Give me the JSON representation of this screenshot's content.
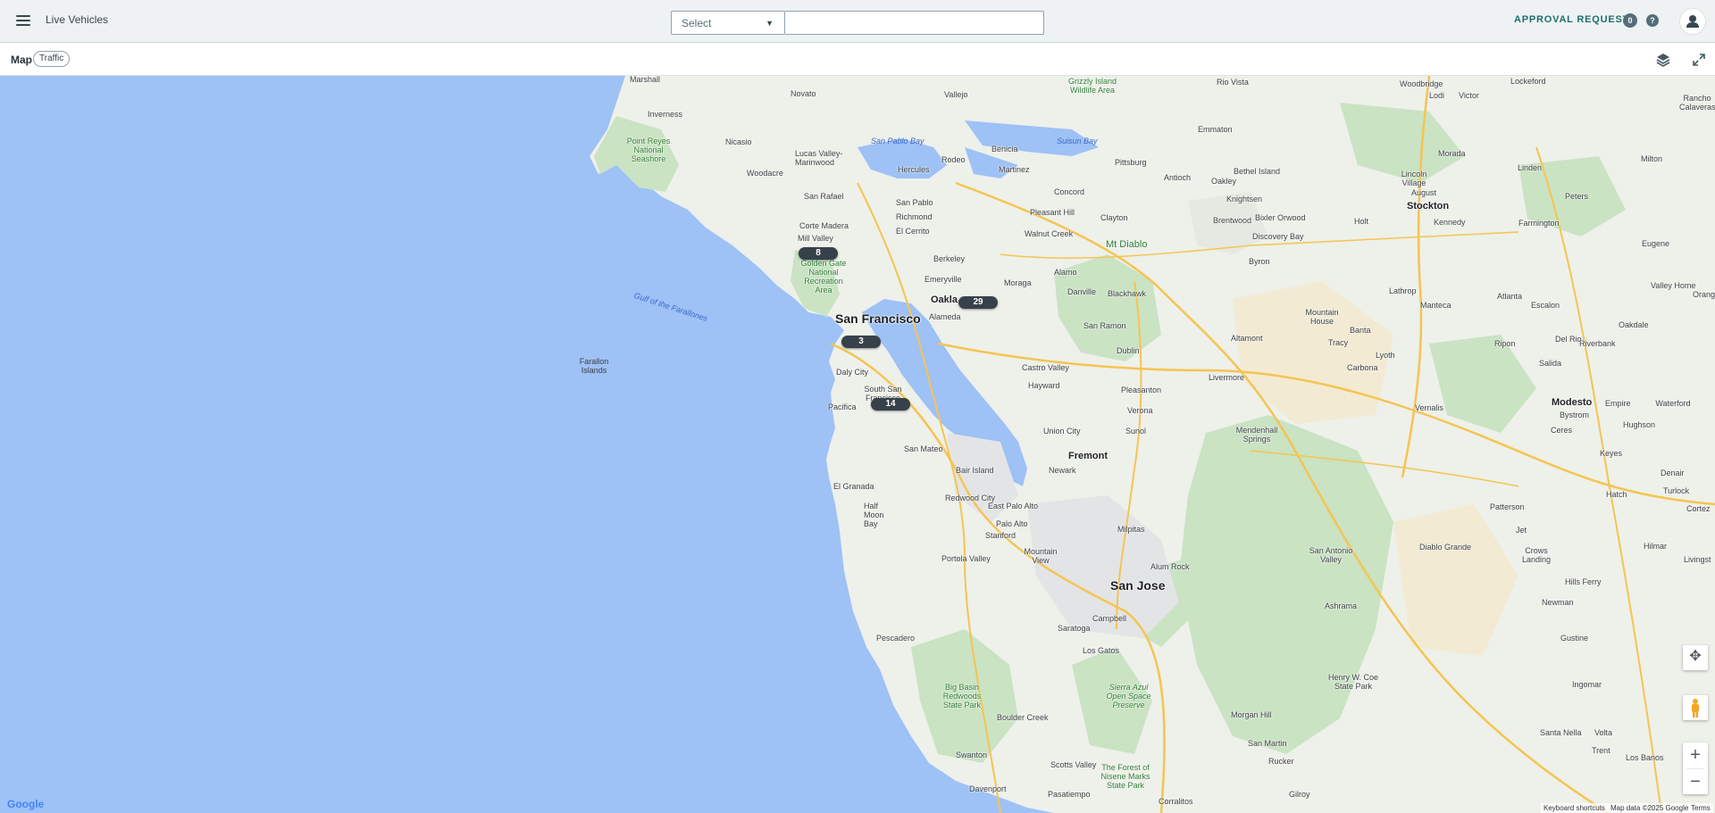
{
  "header": {
    "title": "Live Vehicles",
    "select_label": "Select",
    "search_value": "",
    "search_placeholder": "",
    "approval_label": "APPROVAL REQUESTS",
    "approval_count": "0",
    "help_glyph": "?"
  },
  "subheader": {
    "map_label": "Map",
    "traffic_label": "Traffic"
  },
  "map": {
    "places_major": {
      "san_francisco": "San Francisco",
      "san_jose": "San Jose",
      "oakland": "Oakla",
      "fremont": "Fremont",
      "stockton": "Stockton",
      "modesto": "Modesto"
    },
    "places": {
      "marshall": "Marshall",
      "inverness": "Inverness",
      "novato": "Novato",
      "vallejo": "Vallejo",
      "petaluma_lake": "San Pablo Bay",
      "nicasio": "Nicasio",
      "point_reyes": "Point Reyes National Seashore",
      "lucas_valley": "Lucas Valley-Marinwood",
      "woodacre": "Woodacre",
      "san_rafael": "San Rafael",
      "corte_madera": "Corte Madera",
      "mill_valley": "Mill Valley",
      "golden_gate": "Golden Gate National Recreation Area",
      "san_pablo": "San Pablo",
      "richmond": "Richmond",
      "el_cerrito": "El Cerrito",
      "berkeley": "Berkeley",
      "emeryville": "Emeryville",
      "alameda": "Alameda",
      "hercules": "Hercules",
      "rodeo": "Rodeo",
      "benicia": "Benicia",
      "martinez": "Martinez",
      "concord": "Concord",
      "pleasant_hill": "Pleasant Hill",
      "walnut_creek": "Walnut Creek",
      "clayton": "Clayton",
      "pittsburg": "Pittsburg",
      "antioch": "Antioch",
      "oakley": "Oakley",
      "brentwood": "Brentwood",
      "knightsen": "Knightsen",
      "bethel_island": "Bethel Island",
      "bixler": "Bixler Orwood",
      "discovery_bay": "Discovery Bay",
      "byron": "Byron",
      "mt_diablo": "Mt Diablo",
      "moraga": "Moraga",
      "alamo": "Alamo",
      "danville": "Danville",
      "blackhawk": "Blackhawk",
      "san_ramon": "San Ramon",
      "castro_valley": "Castro Valley",
      "hayward": "Hayward",
      "dublin": "Dublin",
      "pleasanton": "Pleasanton",
      "livermore": "Livermore",
      "altamont": "Altamont",
      "tracy": "Tracy",
      "mountain_house": "Mountain House",
      "lathrop": "Lathrop",
      "manteca": "Manteca",
      "lodi": "Lodi",
      "lincoln_village": "Lincoln Village",
      "kennedy": "Kennedy",
      "morada": "Morada",
      "linden": "Linden",
      "farmington": "Farmington",
      "escalon": "Escalon",
      "ripon": "Ripon",
      "salida": "Salida",
      "riverbank": "Riverbank",
      "oakdale": "Oakdale",
      "empire": "Empire",
      "waterford": "Waterford",
      "hughson": "Hughson",
      "ceres": "Ceres",
      "keyes": "Keyes",
      "denair": "Denair",
      "turlock": "Turlock",
      "patterson": "Patterson",
      "crows_landing": "Crows Landing",
      "newman": "Newman",
      "gustine": "Gustine",
      "daly_city": "Daly City",
      "south_sf": "South San Francisco",
      "pacifica": "Pacifica",
      "san_mateo": "San Mateo",
      "el_granada": "El Granada",
      "half_moon_bay": "Half Moon Bay",
      "redwood_city": "Redwood City",
      "palo_alto": "Palo Alto",
      "east_palo_alto": "East Palo Alto",
      "stanford": "Stanford",
      "mountain_view": "Mountain View",
      "milpitas": "Milpitas",
      "newark": "Newark",
      "union_city": "Union City",
      "sunol": "Sunol",
      "alum_rock": "Alum Rock",
      "campbell": "Campbell",
      "saratoga": "Saratoga",
      "los_gatos": "Los Gatos",
      "portola_valley": "Portola Valley",
      "pescadero": "Pescadero",
      "big_basin": "Big Basin Redwoods State Park",
      "boulder_creek": "Boulder Creek",
      "swanton": "Swanton",
      "davenport": "Davenport",
      "scotts_valley": "Scotts Valley",
      "morgan_hill": "Morgan Hill",
      "san_martin": "San Martin",
      "gilroy": "Gilroy",
      "henry_coe": "Henry W. Coe State Park",
      "san_antonio_valley": "San Antonio Valley",
      "diablo_grande": "Diablo Grande",
      "ashrama": "Ashrama",
      "mendenhall": "Mendenhall Springs",
      "sierra_azul": "Sierra Azul Open Space Preserve",
      "santa_nella": "Santa Nella",
      "los_banos": "Los Banos",
      "farallon": "Farallon Islands",
      "gulf_farallones": "Gulf of the Farallones",
      "grizzly_island": "Grizzly Island Wildlife Area",
      "rio_vista": "Rio Vista",
      "woodbridge": "Woodbridge",
      "lockeford": "Lockeford",
      "victor": "Victor",
      "milton": "Milton",
      "peters": "Peters",
      "eugene": "Eugene",
      "valley_home": "Valley Home",
      "atlanta": "Atlanta",
      "del_rio": "Del Rio",
      "vernalis": "Vernalis",
      "carbona": "Carbona",
      "banta": "Banta",
      "lyoth": "Lyoth",
      "holt": "Holt",
      "bair_island": "Bair Island",
      "emmaton": "Emmaton",
      "verona": "Verona",
      "ingomar": "Ingomar",
      "volta": "Volta",
      "hills_ferry": "Hills Ferry",
      "hilmar": "Hilmar",
      "jet": "Jet",
      "hatch": "Hatch",
      "cortez": "Cortez",
      "livingston": "Livingst",
      "pasatiempo": "Pasatiempo",
      "rucker": "Rucker",
      "corralitos": "Corralitos",
      "forest_nisene": "The Forest of Nisene Marks State Park",
      "bystrom": "Bystrom",
      "suisun_bay": "Suisun Bay",
      "orange": "Orange",
      "rancho": "Rancho Calaveras",
      "trent": "Trent",
      "august": "August"
    },
    "clusters": [
      {
        "id": "c1",
        "count": "8"
      },
      {
        "id": "c2",
        "count": "29"
      },
      {
        "id": "c3",
        "count": "3"
      },
      {
        "id": "c4",
        "count": "14"
      }
    ],
    "attribution": {
      "google": "Google",
      "shortcuts": "Keyboard shortcuts",
      "map_data": "Map data ©2025 Google",
      "terms": "Terms"
    },
    "icons": {
      "menu": "hamburger-menu-icon",
      "layers": "layers-icon",
      "fullscreen": "fullscreen-icon",
      "help": "help-icon",
      "user": "user-icon",
      "pegman": "pegman-icon",
      "camera": "camera-control-icon"
    },
    "colors": {
      "water": "#9ec1f6",
      "land": "#eef0ea",
      "park": "#c9e3c3",
      "cluster": "#37414a",
      "accent": "#1f6f6a"
    },
    "zoom_in": "+",
    "zoom_out": "−"
  }
}
